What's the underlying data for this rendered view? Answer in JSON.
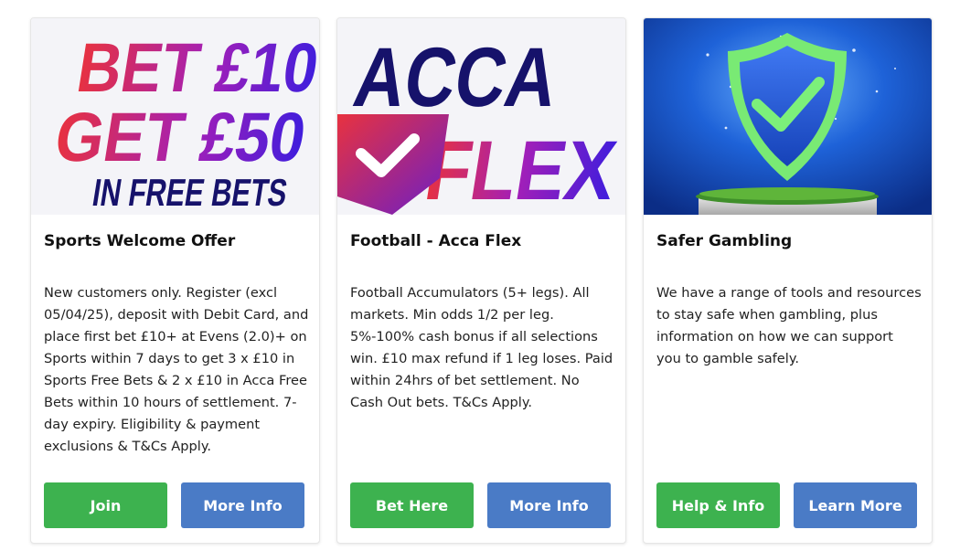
{
  "colors": {
    "primary_button": "#3db24f",
    "secondary_button": "#4a7bc6"
  },
  "cards": [
    {
      "banner": {
        "line1": "BET £10",
        "line2": "GET £50",
        "line3": "IN FREE BETS"
      },
      "title": "Sports Welcome Offer",
      "description": "New customers only. Register (excl 05/04/25), deposit with Debit Card, and place first bet £10+ at Evens (2.0)+ on Sports within 7 days to get 3 x £10 in Sports Free Bets & 2 x £10 in Acca Free Bets within 10 hours of settlement. 7-day expiry. Eligibility & payment exclusions & T&Cs Apply.",
      "primary_label": "Join",
      "secondary_label": "More Info"
    },
    {
      "banner": {
        "line1": "ACCA",
        "line2": "FLEX",
        "icon": "checkmark-shield-icon"
      },
      "title": "Football - Acca Flex",
      "description": "Football Accumulators (5+ legs). All markets. Min odds 1/2 per leg. 5%-100% cash bonus if all selections win. £10 max refund if 1 leg loses. Paid within 24hrs of bet settlement. No Cash Out bets. T&Cs Apply.",
      "primary_label": "Bet Here",
      "secondary_label": "More Info"
    },
    {
      "banner": {
        "icon": "shield-check-icon"
      },
      "title": "Safer Gambling",
      "description": "We have a range of tools and resources to stay safe when gambling, plus information on how we can support you to gamble safely.",
      "primary_label": "Help & Info",
      "secondary_label": "Learn More"
    }
  ]
}
